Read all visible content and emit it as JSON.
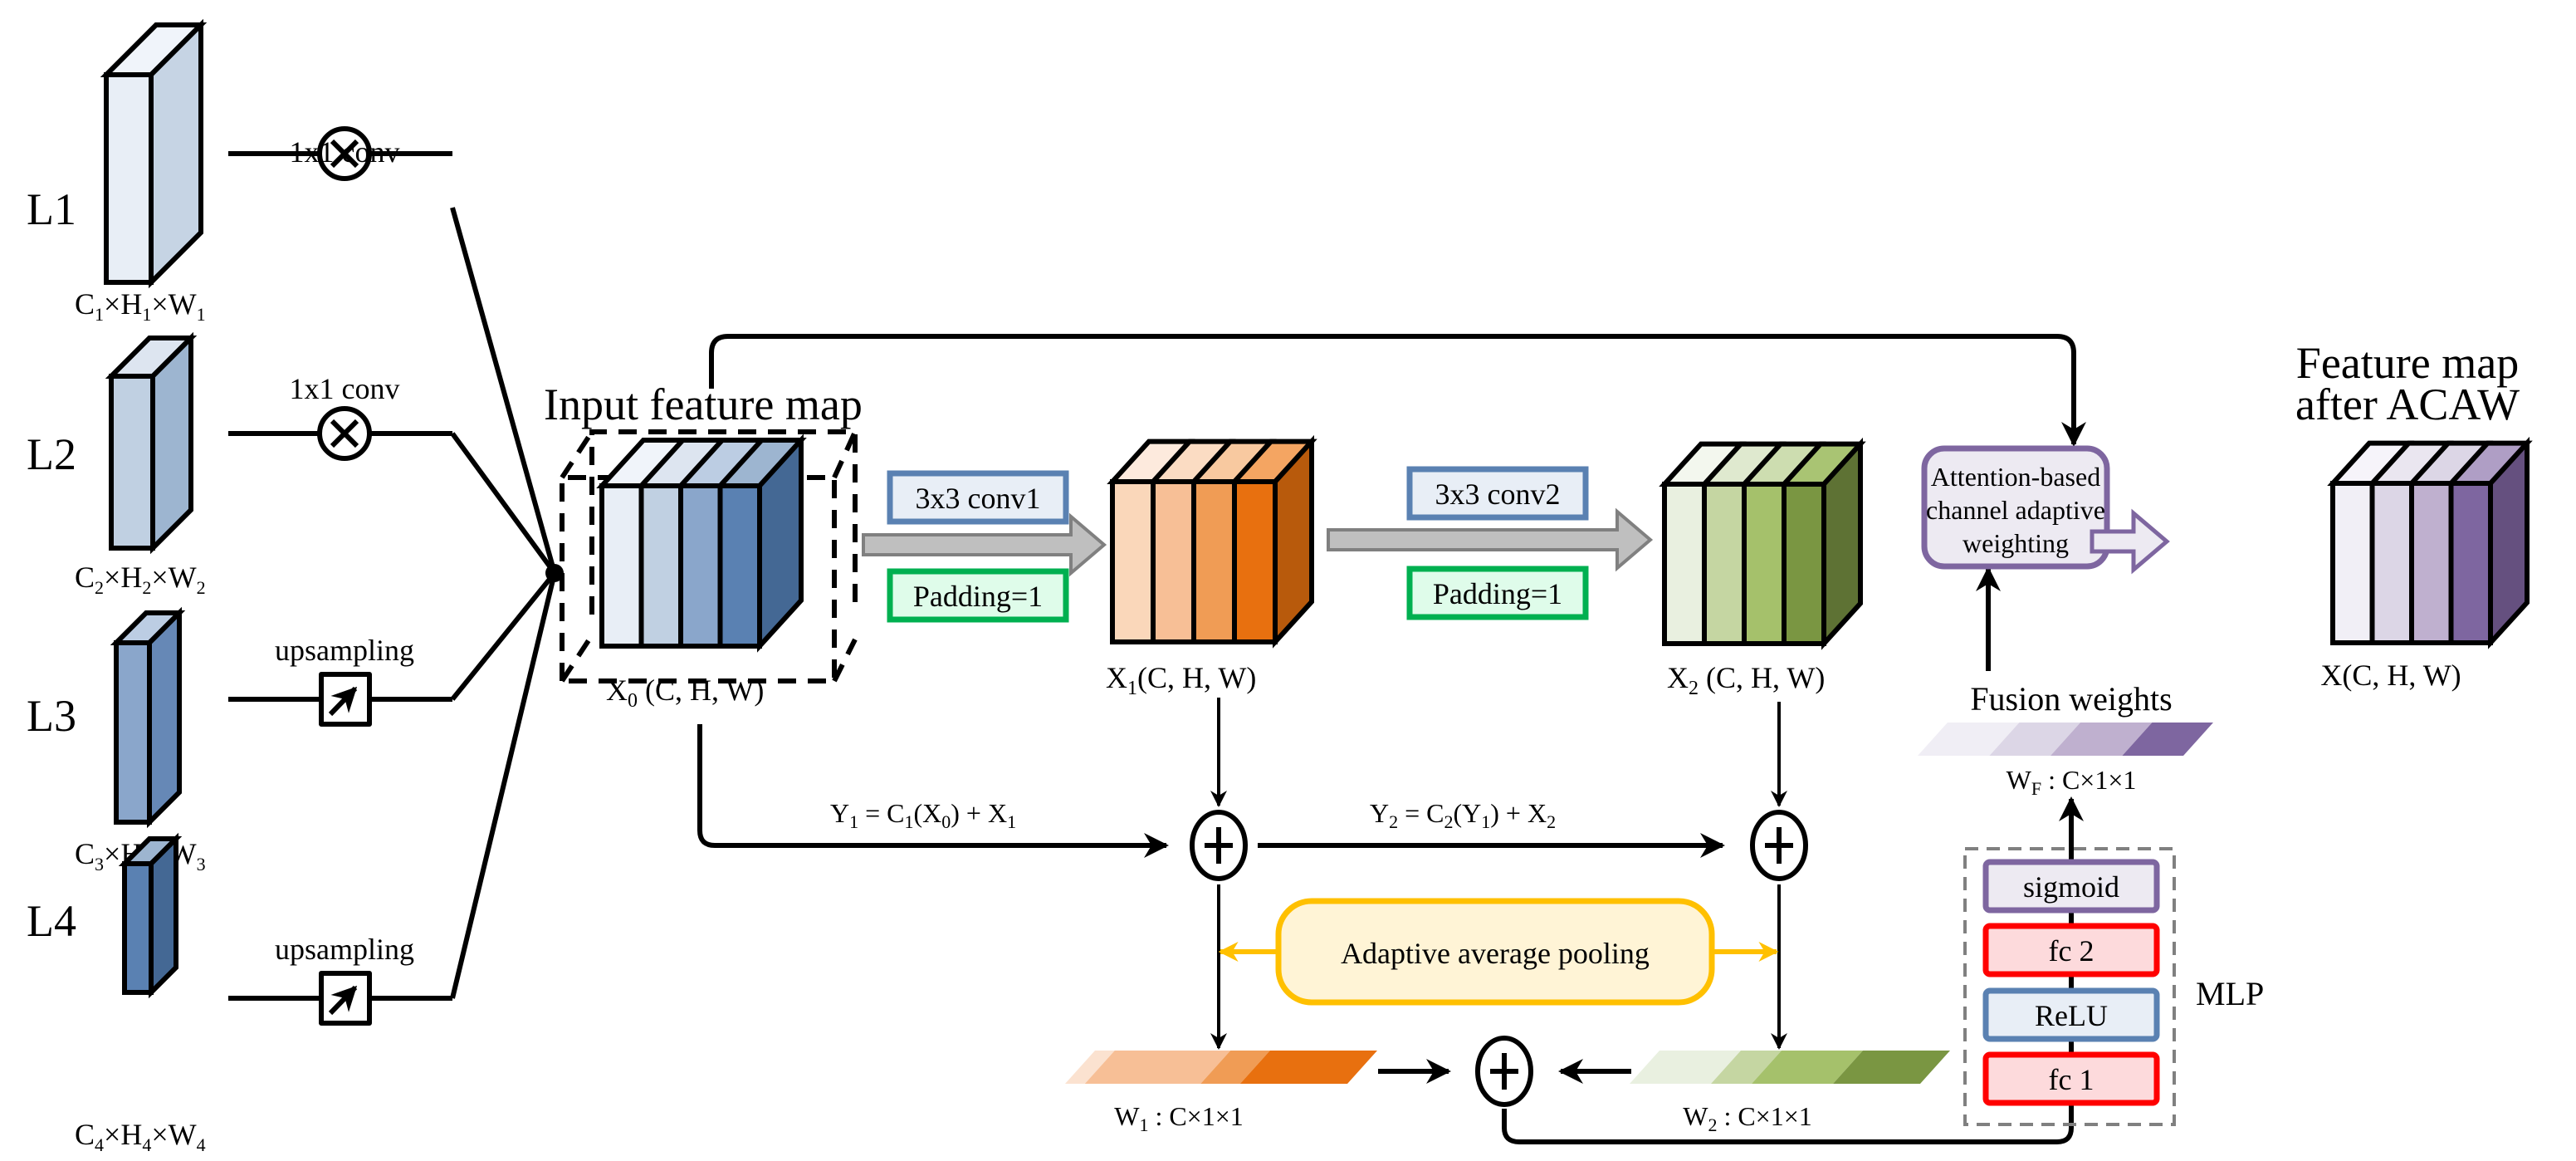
{
  "levels": [
    {
      "label": "L1",
      "dims": {
        "C": "C",
        "sub": "1",
        "H": "H",
        "W": "W"
      },
      "op": "1x1 conv",
      "op_icon": "multiply-circle-icon",
      "front_color": "#E8EEF6",
      "side_color": "#C6D4E4",
      "top_color": "#F0F4FA"
    },
    {
      "label": "L2",
      "dims": {
        "C": "C",
        "sub": "2",
        "H": "H",
        "W": "W"
      },
      "op": "1x1 conv",
      "op_icon": "multiply-circle-icon",
      "front_color": "#C0D0E2",
      "side_color": "#9DB5D0",
      "top_color": "#DDE5F0"
    },
    {
      "label": "L3",
      "dims": {
        "C": "C",
        "sub": "3",
        "H": "H",
        "W": "W"
      },
      "op": "upsampling",
      "op_icon": "upsample-arrow-icon",
      "front_color": "#8AA6CB",
      "side_color": "#6688B6",
      "top_color": "#BCCDE3"
    },
    {
      "label": "L4",
      "dims": {
        "C": "C",
        "sub": "4",
        "H": "H",
        "W": "W"
      },
      "op": "upsampling",
      "op_icon": "upsample-arrow-icon",
      "front_color": "#5A81B2",
      "side_color": "#446894",
      "top_color": "#9DB5D0"
    }
  ],
  "input_map": {
    "title": "Input feature map",
    "label": "X",
    "label_sub": "0",
    "label_rest": " (C, H, W)",
    "slices": [
      "#E8EEF6",
      "#C0D0E2",
      "#8AA6CB",
      "#5A81B2"
    ],
    "tops": [
      "#F0F4FA",
      "#DDE5F0",
      "#BCCDE3",
      "#9DB5D0"
    ],
    "side": "#446894"
  },
  "conv1": {
    "op": "3x3 conv1",
    "padding": "Padding=1"
  },
  "conv2": {
    "op": "3x3 conv2",
    "padding": "Padding=1"
  },
  "x1_map": {
    "label": "X",
    "label_sub": "1",
    "label_rest": "(C, H, W)",
    "slices": [
      "#FAD7BA",
      "#F7BF96",
      "#F09C55",
      "#E8700F"
    ],
    "tops": [
      "#FDEADD",
      "#FBDCC3",
      "#F8C9A0",
      "#F4A562"
    ],
    "side": "#B85A0C"
  },
  "x2_map": {
    "label": "X",
    "label_sub": "2",
    "label_rest": " (C, H, W)",
    "slices": [
      "#E9F0E0",
      "#C5D6A2",
      "#A5C16B",
      "#7A9642"
    ],
    "tops": [
      "#F3F7EE",
      "#DFE9CF",
      "#CDDDB0",
      "#A9C473"
    ],
    "side": "#5E7234"
  },
  "equations": {
    "y1": {
      "lhs": "Y",
      "lhs_sub": "1",
      "mid": " = C",
      "mid_sub": "1",
      "arg": "(X",
      "arg_sub": "0",
      "tail": ") + X",
      "tail_sub": "1"
    },
    "y2": {
      "lhs": "Y",
      "lhs_sub": "2",
      "mid": " = C",
      "mid_sub": "2",
      "arg": "(Y",
      "arg_sub": "1",
      "tail": ") + X",
      "tail_sub": "2"
    }
  },
  "pooling": {
    "label": "Adaptive average pooling",
    "color": "#FFC000",
    "fill": "#FFF4D6"
  },
  "w1": {
    "label": "W",
    "sub": "1",
    "rest": " : C×1×1",
    "colors": [
      "#FBE2D0",
      "#F7BF96",
      "#F09C55",
      "#E8700F"
    ]
  },
  "w2": {
    "label": "W",
    "sub": "2",
    "rest": " : C×1×1",
    "colors": [
      "#E9F0E0",
      "#C5D6A2",
      "#A5C16B",
      "#7A9642"
    ]
  },
  "wf": {
    "title": "Fusion weights",
    "label": "W",
    "sub": "F",
    "rest": " : C×1×1",
    "colors": [
      "#F0EEF5",
      "#DCD6E6",
      "#BFB0CF",
      "#7E66A0"
    ]
  },
  "mlp": {
    "label": "MLP",
    "layers": [
      {
        "name": "sigmoid",
        "border": "#7E66A0",
        "fill": "#EDEAF2"
      },
      {
        "name": "fc 2",
        "border": "#FF0000",
        "fill": "#FDDADC"
      },
      {
        "name": "ReLU",
        "border": "#5A81B2",
        "fill": "#E8EEF6"
      },
      {
        "name": "fc 1",
        "border": "#FF0000",
        "fill": "#FDDADC"
      }
    ]
  },
  "acaw": {
    "lines": [
      "Attention-based",
      "channel adaptive",
      "weighting"
    ],
    "border": "#7E66A0",
    "fill": "#EDEAF2"
  },
  "output_map": {
    "title_lines": [
      "Feature map",
      "after ACAW"
    ],
    "label": "X(C, H, W)",
    "slices": [
      "#F1EFF6",
      "#DCD6E6",
      "#BFB0CF",
      "#7E66A0"
    ],
    "tops": [
      "#F6F4FA",
      "#EAE6F0",
      "#DCD6E6",
      "#AF9EC5"
    ],
    "side": "#65507F"
  },
  "colors": {
    "conv_border": "#5A81B2",
    "conv_fill": "#E8EEF6",
    "pad_border": "#00B050",
    "pad_fill": "#DFFCEA",
    "gray_arrow_fill": "#BFBFBF",
    "gray_arrow_stroke": "#808080",
    "mlp_dash": "#808080"
  }
}
